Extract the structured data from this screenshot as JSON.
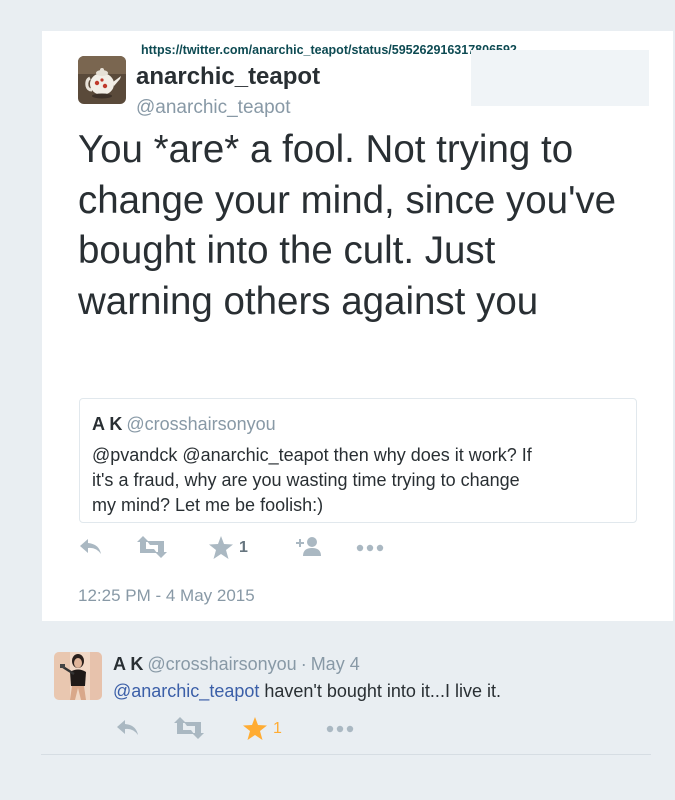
{
  "source_url": "https://twitter.com/anarchic_teapot/status/595262916317806592",
  "tweet": {
    "author_name": "anarchic_teapot",
    "author_handle": "@anarchic_teapot",
    "text": "You *are* a fool. Not trying to change your mind, since you've bought into the cult. Just warning others against you",
    "timestamp": "12:25 PM - 4 May 2015",
    "likes_count": "1",
    "quote": {
      "author_name": "A K",
      "author_handle": "@crosshairsonyou",
      "text": "@pvandck @anarchic_teapot then why does it work?  If it's a fraud, why are you wasting time trying to change my mind? Let me be foolish:)"
    },
    "actions": [
      "reply-icon",
      "retweet-icon",
      "star-icon",
      "follow-icon",
      "more-icon"
    ]
  },
  "reply": {
    "author_name": "A K",
    "author_handle": "@crosshairsonyou",
    "separator": "·",
    "date": "May 4",
    "mention": "@anarchic_teapot",
    "text": " haven't bought into it...I live it.",
    "likes_count": "1",
    "star_color": "#ffac33"
  },
  "colors": {
    "text": "#292f33",
    "muted": "#8899a6",
    "icon": "#aab8c2",
    "link": "#0d4a52",
    "mention": "#3b5fa8",
    "background": "#e9eef2",
    "card": "#ffffff"
  }
}
